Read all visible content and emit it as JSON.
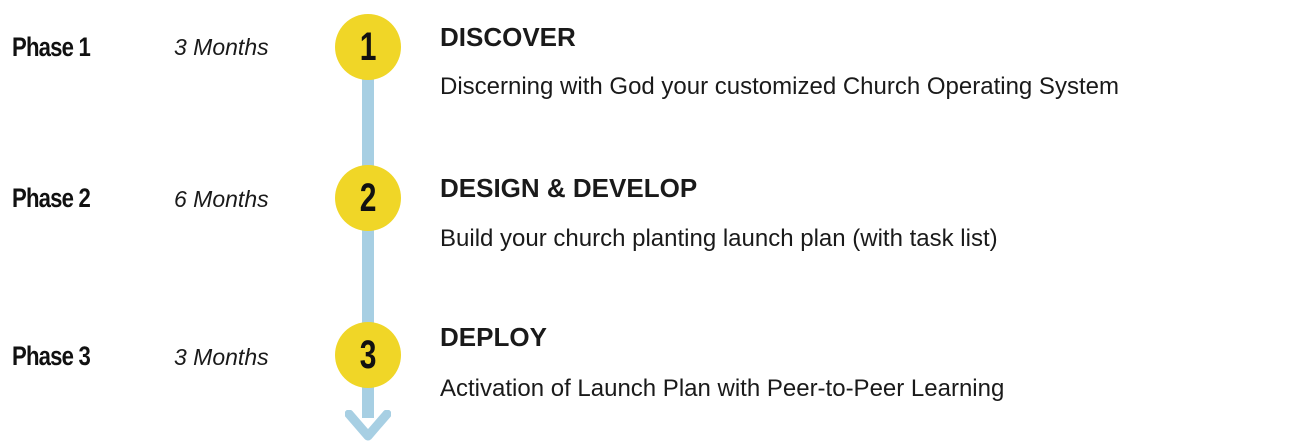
{
  "phases": [
    {
      "label": "Phase 1",
      "duration": "3 Months",
      "number": "1",
      "title": "DISCOVER",
      "description": "Discerning with God your customized Church Operating System"
    },
    {
      "label": "Phase 2",
      "duration": "6 Months",
      "number": "2",
      "title": "DESIGN & DEVELOP",
      "description": "Build your church planting launch plan (with task list)"
    },
    {
      "label": "Phase 3",
      "duration": "3 Months",
      "number": "3",
      "title": "DEPLOY",
      "description": "Activation of Launch Plan with Peer-to-Peer Learning"
    }
  ],
  "colors": {
    "timeline": "#a7cfe3",
    "circle": "#f0d627",
    "text": "#1a1a1a"
  },
  "icons": {
    "timeline_end": "arrow-down-icon"
  }
}
